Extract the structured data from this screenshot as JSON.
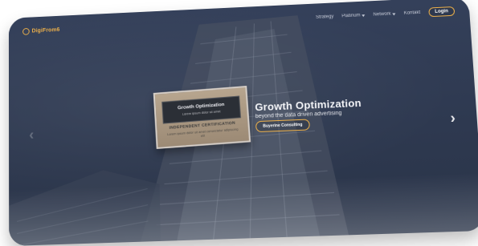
{
  "brand": {
    "name": "DigiFrom6"
  },
  "nav": {
    "items": [
      {
        "label": "Strategy"
      },
      {
        "label": "Platinum",
        "has_dropdown": true
      },
      {
        "label": "Network",
        "has_dropdown": true
      },
      {
        "label": "Kontakt"
      }
    ],
    "login_label": "Login"
  },
  "hero": {
    "title": "Growth Optimization",
    "subtitle": "beyond the data driven advertising",
    "cta_label": "Buyerine Consulting"
  },
  "certificate": {
    "title": "Growth Optimization",
    "subtitle": "Lorem ipsum dolor sit amet",
    "label": "INDEPENDENT CERTIFICATION",
    "description": "Lorem ipsum dolor sit amet consectetur adipiscing elit"
  },
  "carousel": {
    "prev_icon": "chevron-left-icon",
    "next_icon": "chevron-right-icon"
  },
  "colors": {
    "accent": "#f0b24a",
    "bg": "#2f3a52"
  }
}
